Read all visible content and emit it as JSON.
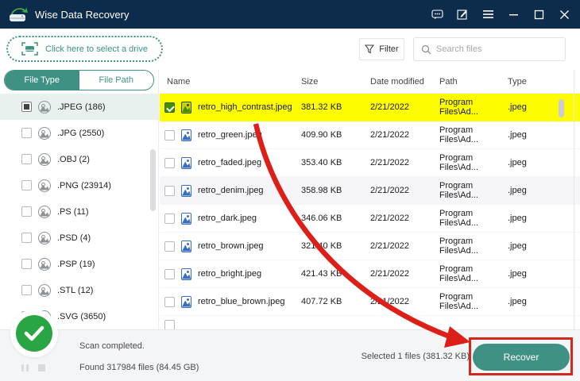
{
  "window": {
    "title": "Wise Data Recovery"
  },
  "toolbar": {
    "drive_selector": "Click here to select a drive",
    "filter": "Filter",
    "search_placeholder": "Search files"
  },
  "sidebar": {
    "tabs": [
      {
        "label": "File Type"
      },
      {
        "label": "File Path"
      }
    ],
    "items": [
      {
        "label": ".JPEG (186)",
        "indeterminate": true,
        "selected": true
      },
      {
        "label": ".JPG (2550)"
      },
      {
        "label": ".OBJ (2)"
      },
      {
        "label": ".PNG (23914)"
      },
      {
        "label": ".PS (11)"
      },
      {
        "label": ".PSD (4)"
      },
      {
        "label": ".PSP (19)"
      },
      {
        "label": ".STL (12)"
      },
      {
        "label": ".SVG (3650)"
      }
    ]
  },
  "table": {
    "columns": [
      "Name",
      "Size",
      "Date modified",
      "Path",
      "Type"
    ],
    "rows": [
      {
        "name": "retro_high_contrast.jpeg",
        "size": "381.32 KB",
        "date": "2/21/2022",
        "path": "Program Files\\Ad...",
        "type": ".jpeg",
        "checked": true,
        "highlighted": true
      },
      {
        "name": "retro_green.jpeg",
        "size": "409.90 KB",
        "date": "2/21/2022",
        "path": "Program Files\\Ad...",
        "type": ".jpeg"
      },
      {
        "name": "retro_faded.jpeg",
        "size": "353.40 KB",
        "date": "2/21/2022",
        "path": "Program Files\\Ad...",
        "type": ".jpeg"
      },
      {
        "name": "retro_denim.jpeg",
        "size": "358.98 KB",
        "date": "2/21/2022",
        "path": "Program Files\\Ad...",
        "type": ".jpeg",
        "striped": true
      },
      {
        "name": "retro_dark.jpeg",
        "size": "346.06 KB",
        "date": "2/21/2022",
        "path": "Program Files\\Ad...",
        "type": ".jpeg"
      },
      {
        "name": "retro_brown.jpeg",
        "size": "321.40 KB",
        "date": "2/21/2022",
        "path": "Program Files\\Ad...",
        "type": ".jpeg"
      },
      {
        "name": "retro_bright.jpeg",
        "size": "421.43 KB",
        "date": "2/21/2022",
        "path": "Program Files\\Ad...",
        "type": ".jpeg"
      },
      {
        "name": "retro_blue_brown.jpeg",
        "size": "407.72 KB",
        "date": "2/21/2022",
        "path": "Program Files\\Ad...",
        "type": ".jpeg"
      }
    ]
  },
  "footer": {
    "status_primary": "Scan completed.",
    "status_secondary": "Found 317984 files (84.45 GB)",
    "selected_info": "Selected 1 files (381.32 KB)",
    "recover": "Recover"
  },
  "colors": {
    "titlebar_bg": "#0d2b4a",
    "accent_teal": "#3f9184",
    "highlight_yellow": "#fdfc00",
    "annotation_red": "#d4281e",
    "success_green": "#29a643"
  }
}
